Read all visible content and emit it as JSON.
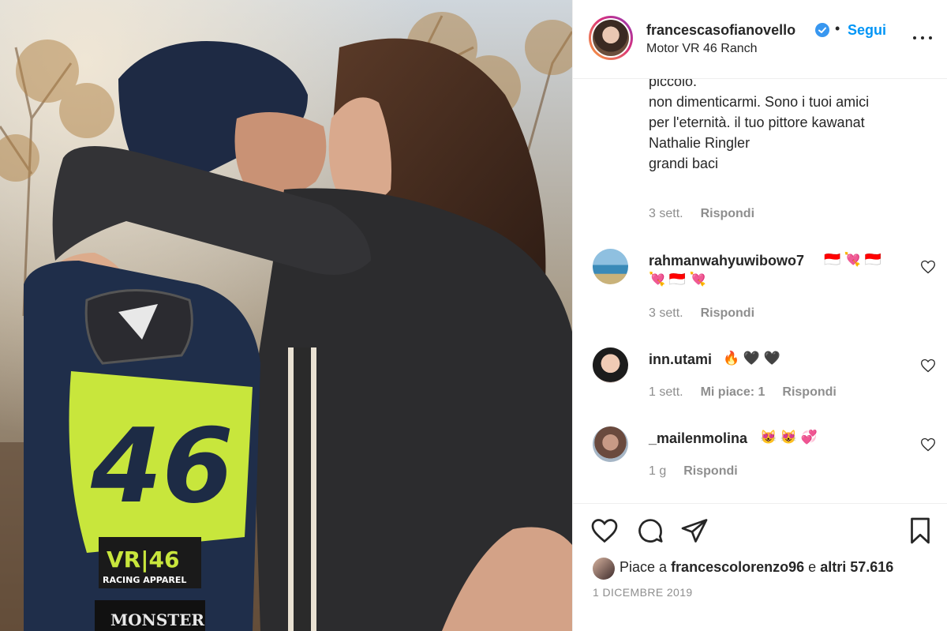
{
  "post": {
    "username": "francescasofianovello",
    "separator": "•",
    "follow_label": "Segui",
    "location": "Motor VR 46 Ranch"
  },
  "caption": {
    "lines": [
      "piccolo.",
      "non dimenticarmi. Sono i tuoi amici",
      "per l'eternità. il tuo pittore kawanat",
      "Nathalie Ringler",
      "",
      "grandi baci"
    ],
    "time": "3 sett.",
    "reply_label": "Rispondi"
  },
  "comments": [
    {
      "user": "rahmanwahyuwibowo7",
      "text_line1": "🇮🇩 💘 🇮🇩",
      "text_line2": "💘 🇮🇩 💘",
      "time": "3 sett.",
      "reply_label": "Rispondi",
      "likes": ""
    },
    {
      "user": "inn.utami",
      "text_line1": "🔥 🖤 🖤",
      "text_line2": "",
      "time": "1 sett.",
      "reply_label": "Rispondi",
      "likes": "Mi piace: 1"
    },
    {
      "user": "_mailenmolina",
      "text_line1": "😻 😻 💞",
      "text_line2": "",
      "time": "1 g",
      "reply_label": "Rispondi",
      "likes": ""
    }
  ],
  "likes": {
    "prefix": "Piace a",
    "user": "francescolorenzo96",
    "middle": "e",
    "count_text": "altri 57.616"
  },
  "date": "1 DICEMBRE 2019",
  "photo": {
    "number_text": "46",
    "brand_text": "VR|46",
    "brand_sub": "RACING APPAREL",
    "sponsor_text": "MONSTER"
  },
  "icons": {
    "verified": "verified-badge-icon",
    "more": "more-options-icon",
    "like": "heart-icon",
    "comment": "comment-icon",
    "share": "share-icon",
    "save": "bookmark-icon"
  },
  "colors": {
    "accent": "#0095f6",
    "text": "#262626",
    "muted": "#8e8e8e",
    "jersey_yellow": "#c8e63c"
  }
}
